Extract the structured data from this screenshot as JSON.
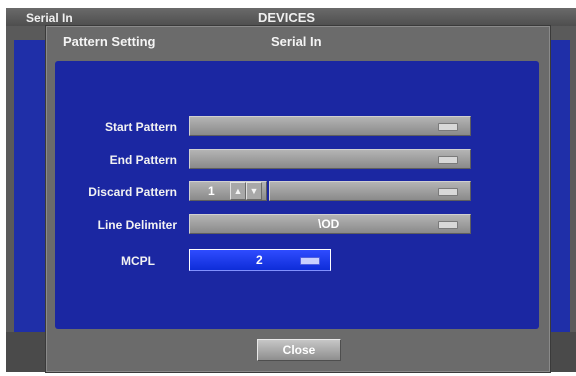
{
  "background_window": {
    "title_left": "Serial In",
    "title_center": "DEVICES"
  },
  "dialog": {
    "title": "Pattern Setting",
    "subtitle": "Serial In",
    "fields": {
      "start_pattern": {
        "label": "Start Pattern",
        "value": ""
      },
      "end_pattern": {
        "label": "End Pattern",
        "value": ""
      },
      "discard_pattern": {
        "label": "Discard Pattern",
        "count": "1",
        "value": ""
      },
      "line_delimiter": {
        "label": "Line Delimiter",
        "value": "\\OD"
      },
      "mcpl": {
        "label": "MCPL",
        "value": "2"
      }
    },
    "close_label": "Close"
  }
}
